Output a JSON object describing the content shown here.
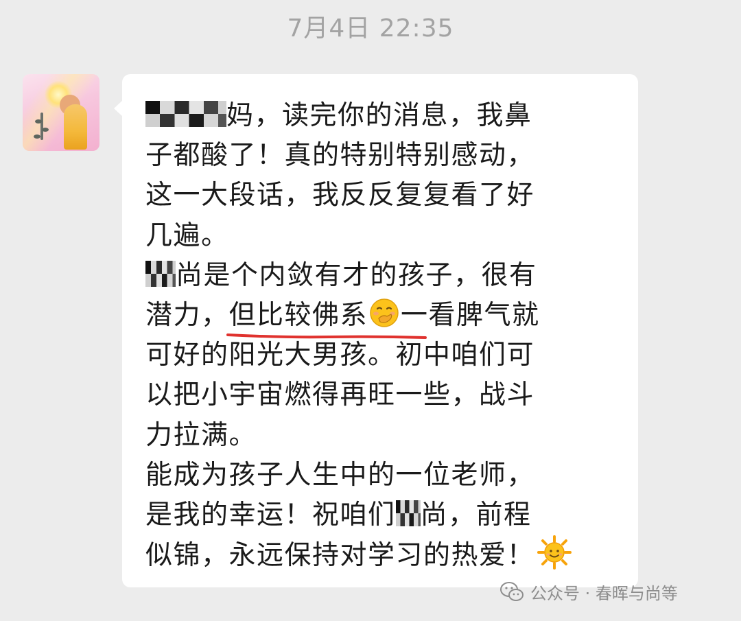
{
  "timestamp": "7月4日 22:35",
  "message": {
    "lines": [
      {
        "pre": "",
        "after": "妈，读完你的消息，我鼻"
      },
      {
        "text": "子都酸了！真的特别特别感动，"
      },
      {
        "text": "这一大段话，我反反复复看了好"
      },
      {
        "text": "几遍。"
      },
      {
        "pre": "",
        "after": "尚是个内敛有才的孩子，很有"
      },
      {
        "before": "潜力，",
        "highlight": "但比较佛系",
        "after": "一看脾气就"
      },
      {
        "text": "可好的阳光大男孩。初中咱们可"
      },
      {
        "text": "以把小宇宙燃得再旺一些，战斗"
      },
      {
        "text": "力拉满。"
      },
      {
        "text": "能成为孩子人生中的一位老师，"
      },
      {
        "before": "是我的幸运！祝咱们",
        "after": "尚，前程"
      },
      {
        "text": "似锦，永远保持对学习的热爱！"
      }
    ]
  },
  "watermark": {
    "text": "公众号 · 春晖与尚等"
  },
  "colors": {
    "background": "#ececec",
    "bubble": "#ffffff",
    "timestamp": "#a3a3a3",
    "text": "#1a1a1a",
    "underline": "#e0322e",
    "watermark": "#8d8d8d"
  },
  "icons": {
    "emoji_1": "hand-over-mouth-emoji",
    "emoji_2": "sun-with-face-emoji",
    "watermark_icon": "wechat-icon"
  }
}
